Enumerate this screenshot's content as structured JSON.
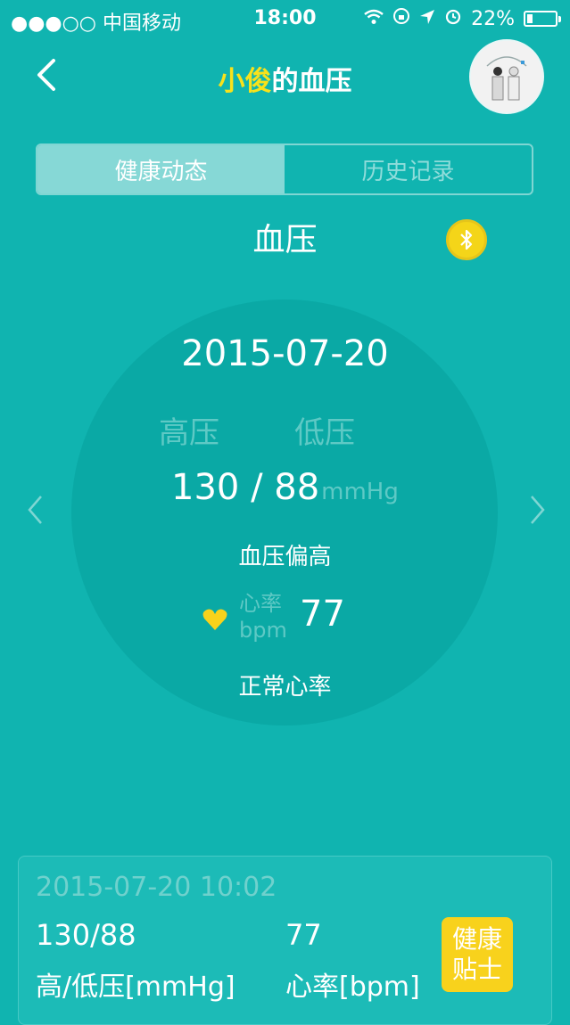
{
  "status_bar": {
    "carrier": "●●●○○ 中国移动",
    "time": "18:00",
    "battery": "22%"
  },
  "header": {
    "name": "小俊",
    "title_suffix": "的血压",
    "back_icon": "chevron-left-icon",
    "avatar_icon": "user-avatar"
  },
  "tabs": [
    {
      "label": "健康动态",
      "active": true
    },
    {
      "label": "历史记录",
      "active": false
    }
  ],
  "section_title": "血压",
  "bluetooth_icon": "bluetooth-icon",
  "reading": {
    "date": "2015-07-20",
    "high_label": "高压",
    "low_label": "低压",
    "value": "130 / 88",
    "unit": "mmHg",
    "status": "血压偏高",
    "heart_rate_label": "心率",
    "heart_rate_unit": "bpm",
    "heart_rate_value": "77",
    "heart_rate_status": "正常心率"
  },
  "record_card": {
    "datetime": "2015-07-20 10:02",
    "bp_value": "130/88",
    "hr_value": "77",
    "bp_label": "高/低压[mmHg]",
    "hr_label": "心率[bpm]",
    "tips_button": "健康贴士"
  },
  "colors": {
    "background": "#10b4b0",
    "accent_yellow": "#f8d21c",
    "name_yellow": "#f8e21b"
  }
}
